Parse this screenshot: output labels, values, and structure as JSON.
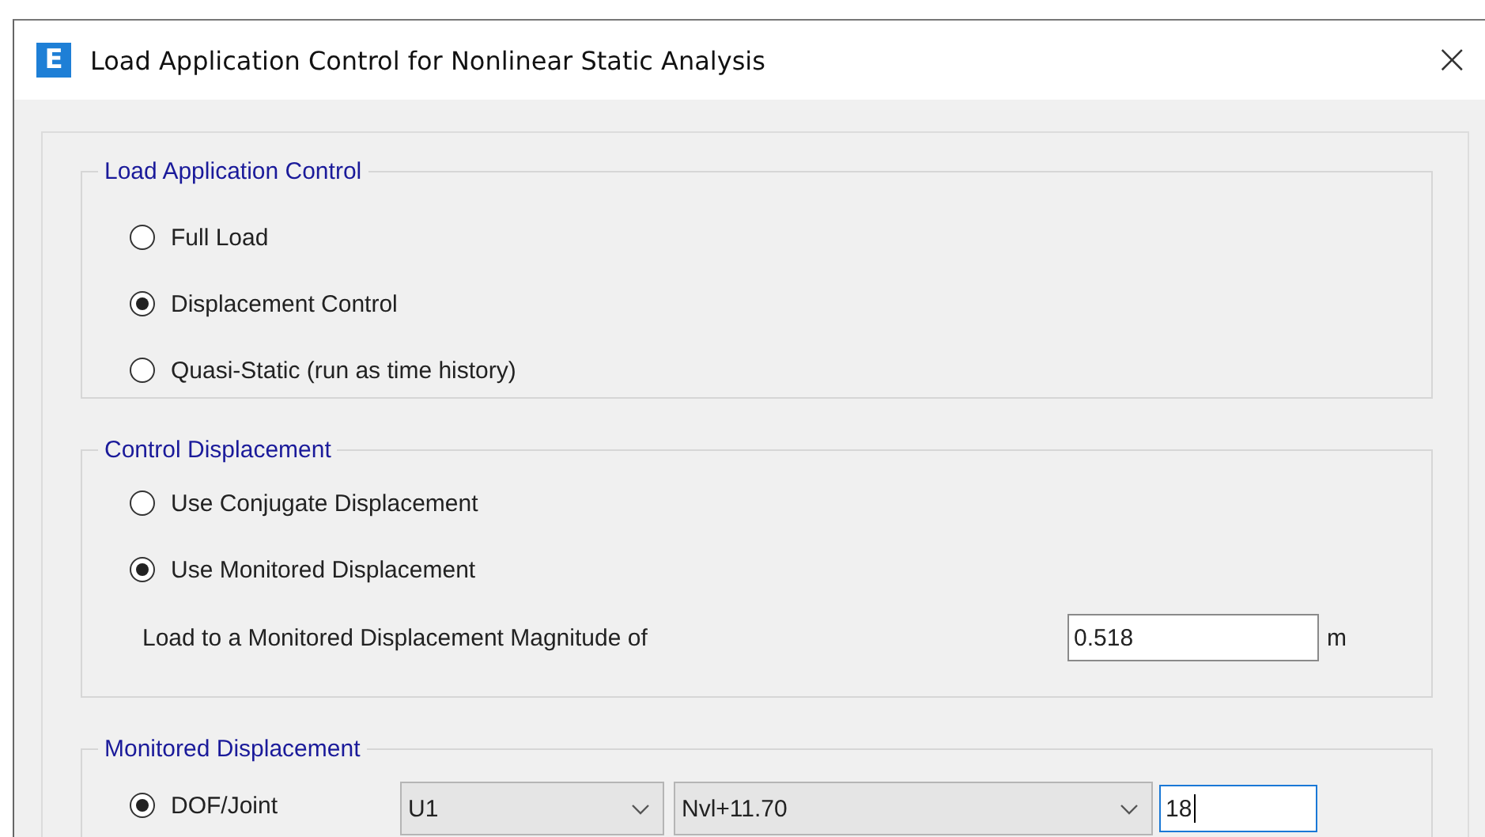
{
  "window": {
    "title": "Load Application Control for Nonlinear Static Analysis",
    "close": "×",
    "app_icon": "E"
  },
  "load_application_control": {
    "legend": "Load Application Control",
    "options": [
      {
        "label": "Full Load",
        "selected": false
      },
      {
        "label": "Displacement Control",
        "selected": true
      },
      {
        "label": "Quasi-Static (run as time history)",
        "selected": false
      }
    ]
  },
  "control_displacement": {
    "legend": "Control Displacement",
    "options": [
      {
        "label": "Use Conjugate Displacement",
        "selected": false
      },
      {
        "label": "Use Monitored Displacement",
        "selected": true
      }
    ],
    "magnitude": {
      "label": "Load to a Monitored Displacement Magnitude of",
      "value": "0.518",
      "unit": "m",
      "focused": false
    }
  },
  "monitored_displacement": {
    "legend": "Monitored Displacement",
    "option": {
      "label": "DOF/Joint",
      "selected": true
    },
    "dof": {
      "value": "U1"
    },
    "joint": {
      "value": "Nvl+11.70"
    },
    "point": {
      "value": "18",
      "focused": true
    }
  }
}
